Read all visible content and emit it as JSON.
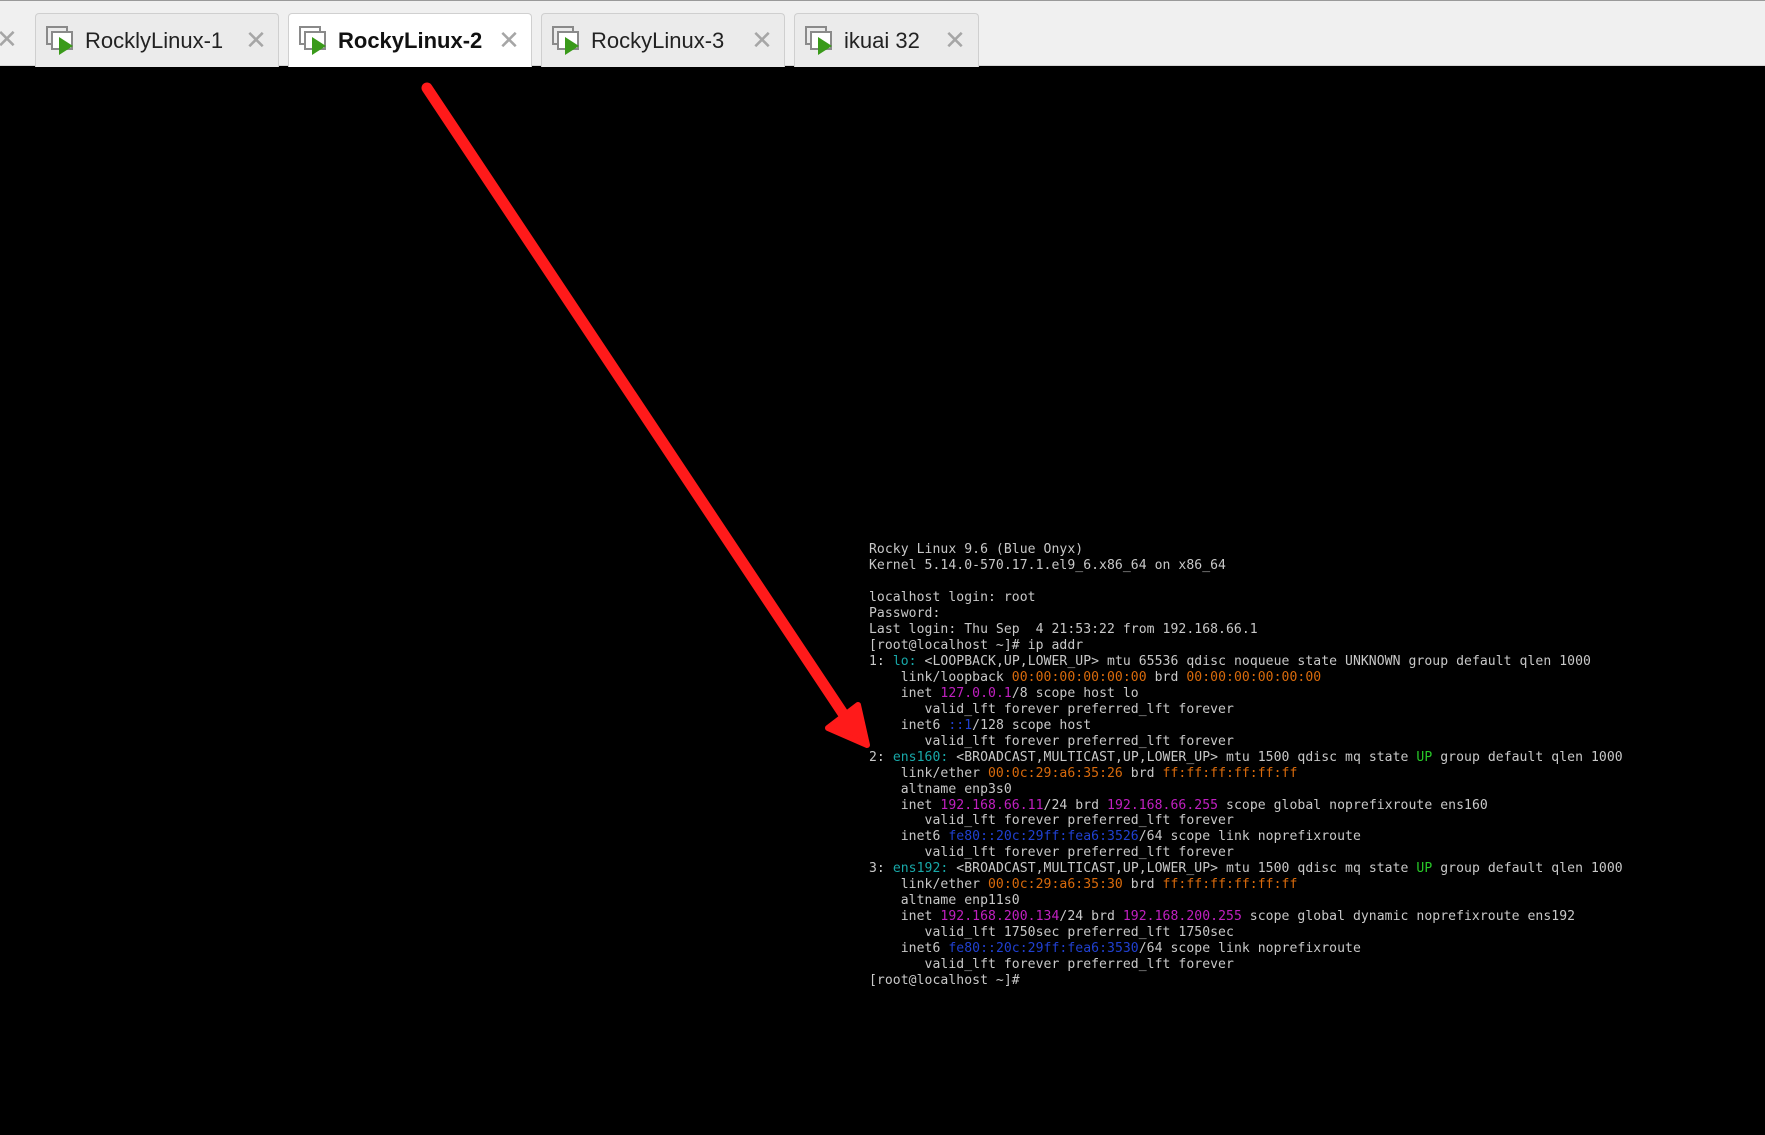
{
  "tabs": [
    {
      "label": "RocklyLinux-1",
      "active": false
    },
    {
      "label": "RockyLinux-2",
      "active": true
    },
    {
      "label": "RockyLinux-3",
      "active": false
    },
    {
      "label": "ikuai 32",
      "active": false
    }
  ],
  "icons": {
    "tab_icon": "vm-play-icon",
    "close": "close-icon"
  },
  "close_glyph": "✕",
  "colors": {
    "tabbar_bg": "#f0f0f0",
    "console_bg": "#000000",
    "console_text": "#c8c8c8",
    "magenta": "#c020c0",
    "orange": "#d86a0c",
    "cyan": "#18a8a8",
    "green": "#28c828",
    "blue": "#2040d0",
    "arrow": "#ff1a1a"
  },
  "console": {
    "lines": [
      [
        {
          "t": "Rocky Linux 9.6 (Blue Onyx)"
        }
      ],
      [
        {
          "t": "Kernel 5.14.0-570.17.1.el9_6.x86_64 on x86_64"
        }
      ],
      [
        {
          "t": ""
        }
      ],
      [
        {
          "t": "localhost login: root"
        }
      ],
      [
        {
          "t": "Password:"
        }
      ],
      [
        {
          "t": "Last login: Thu Sep  4 21:53:22 from 192.168.66.1"
        }
      ],
      [
        {
          "t": "[root@localhost ~]# ip addr"
        }
      ],
      [
        {
          "t": "1: "
        },
        {
          "t": "lo:",
          "c": "cy"
        },
        {
          "t": " <LOOPBACK,UP,LOWER_UP> mtu 65536 qdisc noqueue state UNKNOWN group default qlen 1000"
        }
      ],
      [
        {
          "t": "    link/loopback "
        },
        {
          "t": "00:00:00:00:00:00",
          "c": "or"
        },
        {
          "t": " brd "
        },
        {
          "t": "00:00:00:00:00:00",
          "c": "or"
        }
      ],
      [
        {
          "t": "    inet "
        },
        {
          "t": "127.0.0.1",
          "c": "mg"
        },
        {
          "t": "/8 scope host lo"
        }
      ],
      [
        {
          "t": "       valid_lft forever preferred_lft forever"
        }
      ],
      [
        {
          "t": "    inet6 "
        },
        {
          "t": "::1",
          "c": "bl"
        },
        {
          "t": "/128 scope host"
        }
      ],
      [
        {
          "t": "       valid_lft forever preferred_lft forever"
        }
      ],
      [
        {
          "t": "2: "
        },
        {
          "t": "ens160:",
          "c": "cy"
        },
        {
          "t": " <BROADCAST,MULTICAST,UP,LOWER_UP> mtu 1500 qdisc mq state "
        },
        {
          "t": "UP",
          "c": "gr"
        },
        {
          "t": " group default qlen 1000"
        }
      ],
      [
        {
          "t": "    link/ether "
        },
        {
          "t": "00:0c:29:a6:35:26",
          "c": "or"
        },
        {
          "t": " brd "
        },
        {
          "t": "ff:ff:ff:ff:ff:ff",
          "c": "or"
        }
      ],
      [
        {
          "t": "    altname enp3s0"
        }
      ],
      [
        {
          "t": "    inet "
        },
        {
          "t": "192.168.66.11",
          "c": "mg"
        },
        {
          "t": "/24 brd "
        },
        {
          "t": "192.168.66.255",
          "c": "mg"
        },
        {
          "t": " scope global noprefixroute ens160"
        }
      ],
      [
        {
          "t": "       valid_lft forever preferred_lft forever"
        }
      ],
      [
        {
          "t": "    inet6 "
        },
        {
          "t": "fe80::20c:29ff:fea6:3526",
          "c": "bl"
        },
        {
          "t": "/64 scope link noprefixroute"
        }
      ],
      [
        {
          "t": "       valid_lft forever preferred_lft forever"
        }
      ],
      [
        {
          "t": "3: "
        },
        {
          "t": "ens192:",
          "c": "cy"
        },
        {
          "t": " <BROADCAST,MULTICAST,UP,LOWER_UP> mtu 1500 qdisc mq state "
        },
        {
          "t": "UP",
          "c": "gr"
        },
        {
          "t": " group default qlen 1000"
        }
      ],
      [
        {
          "t": "    link/ether "
        },
        {
          "t": "00:0c:29:a6:35:30",
          "c": "or"
        },
        {
          "t": " brd "
        },
        {
          "t": "ff:ff:ff:ff:ff:ff",
          "c": "or"
        }
      ],
      [
        {
          "t": "    altname enp11s0"
        }
      ],
      [
        {
          "t": "    inet "
        },
        {
          "t": "192.168.200.134",
          "c": "mg"
        },
        {
          "t": "/24 brd "
        },
        {
          "t": "192.168.200.255",
          "c": "mg"
        },
        {
          "t": " scope global dynamic noprefixroute ens192"
        }
      ],
      [
        {
          "t": "       valid_lft 1750sec preferred_lft 1750sec"
        }
      ],
      [
        {
          "t": "    inet6 "
        },
        {
          "t": "fe80::20c:29ff:fea6:3530",
          "c": "bl"
        },
        {
          "t": "/64 scope link noprefixroute"
        }
      ],
      [
        {
          "t": "       valid_lft forever preferred_lft forever"
        }
      ],
      [
        {
          "t": "[root@localhost ~]#"
        }
      ]
    ]
  }
}
